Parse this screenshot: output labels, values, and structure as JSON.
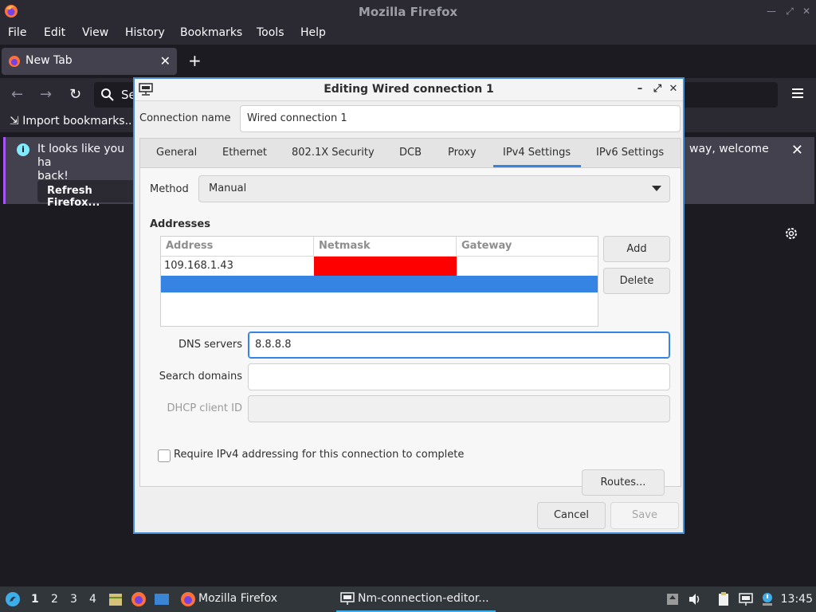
{
  "firefox": {
    "window_title": "Mozilla Firefox",
    "menu": [
      "File",
      "Edit",
      "View",
      "History",
      "Bookmarks",
      "Tools",
      "Help"
    ],
    "tab_label": "New Tab",
    "url_placeholder": "Se",
    "import_bookmarks": "Import bookmarks...",
    "notice_left": "It looks like you ha",
    "notice_left_2": "back!",
    "notice_right": "way, welcome",
    "refresh_button": "Refresh Firefox..."
  },
  "dialog": {
    "title": "Editing Wired connection 1",
    "connection_name_label": "Connection name",
    "connection_name_value": "Wired connection 1",
    "tabs": [
      "General",
      "Ethernet",
      "802.1X Security",
      "DCB",
      "Proxy",
      "IPv4 Settings",
      "IPv6 Settings"
    ],
    "active_tab": "IPv4 Settings",
    "method_label": "Method",
    "method_value": "Manual",
    "addresses_heading": "Addresses",
    "columns": [
      "Address",
      "Netmask",
      "Gateway"
    ],
    "rows": [
      {
        "address": "109.168.1.43",
        "netmask": "",
        "gateway": ""
      }
    ],
    "add_button": "Add",
    "delete_button": "Delete",
    "dns_label": "DNS servers",
    "dns_value": "8.8.8.8",
    "search_domains_label": "Search domains",
    "search_domains_value": "",
    "dhcp_label": "DHCP client ID",
    "dhcp_value": "",
    "require_label": "Require IPv4 addressing for this connection to complete",
    "require_checked": false,
    "routes_button": "Routes...",
    "cancel_button": "Cancel",
    "save_button": "Save"
  },
  "taskbar": {
    "workspaces": [
      "1",
      "2",
      "3",
      "4"
    ],
    "firefox_task": "Mozilla Firefox",
    "nm_task": "Nm-connection-editor...",
    "clock": "13:45"
  },
  "colors": {
    "accent": "#3584e4",
    "netmask_highlight": "#ff0000",
    "notice_stripe": "#a855f7"
  }
}
